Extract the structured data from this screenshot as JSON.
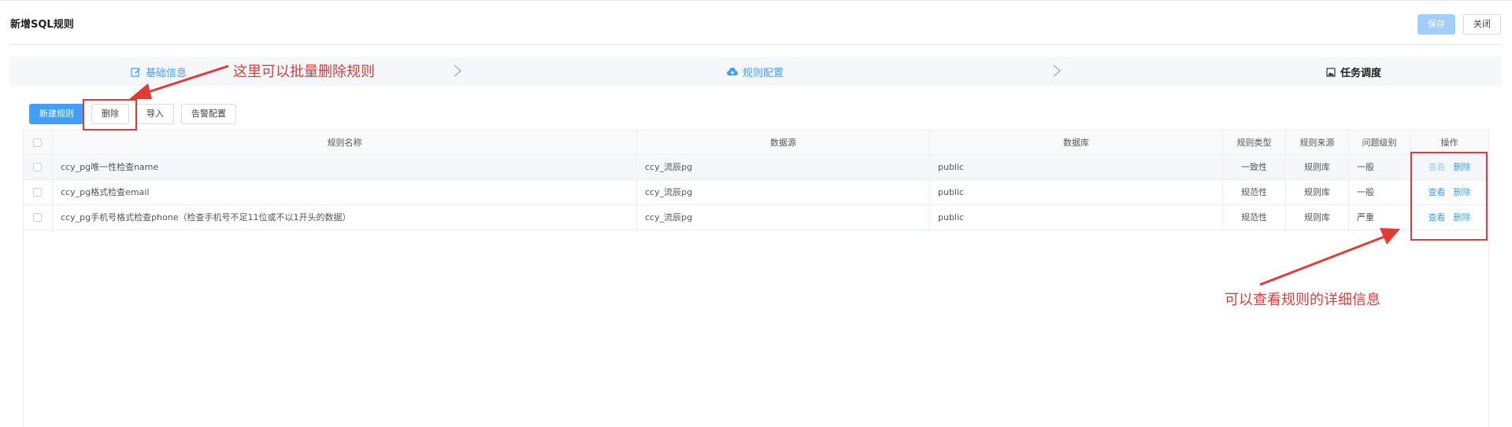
{
  "header": {
    "title": "新增SQL规则",
    "save_label": "保存",
    "close_label": "关闭"
  },
  "steps": [
    {
      "label": "基础信息",
      "icon": "edit-icon"
    },
    {
      "label": "规则配置",
      "icon": "cloud-upload-icon"
    },
    {
      "label": "任务调度",
      "icon": "image-icon"
    }
  ],
  "toolbar": {
    "new_label": "新建规则",
    "delete_label": "删除",
    "import_label": "导入",
    "alarm_label": "告警配置"
  },
  "table": {
    "columns": [
      "规则名称",
      "数据源",
      "数据库",
      "规则类型",
      "规则来源",
      "问题级别",
      "操作"
    ],
    "rows": [
      {
        "name": "ccy_pg唯一性检查name",
        "source": "ccy_流辰pg",
        "db": "public",
        "type": "一致性",
        "from": "规则库",
        "level": "一般",
        "view": "查看",
        "delete": "删除"
      },
      {
        "name": "ccy_pg格式检查email",
        "source": "ccy_流辰pg",
        "db": "public",
        "type": "规范性",
        "from": "规则库",
        "level": "一般",
        "view": "查看",
        "delete": "删除"
      },
      {
        "name": "ccy_pg手机号格式检查phone（检查手机号不足11位或不以1开头的数据）",
        "source": "ccy_流辰pg",
        "db": "public",
        "type": "规范性",
        "from": "规则库",
        "level": "严重",
        "view": "查看",
        "delete": "删除"
      }
    ]
  },
  "annotations": {
    "batch_delete": "这里可以批量删除规则",
    "view_detail": "可以查看规则的详细信息"
  },
  "colors": {
    "primary": "#409eff",
    "primary_light": "#a0cfff",
    "annotation_red": "#e53935"
  }
}
